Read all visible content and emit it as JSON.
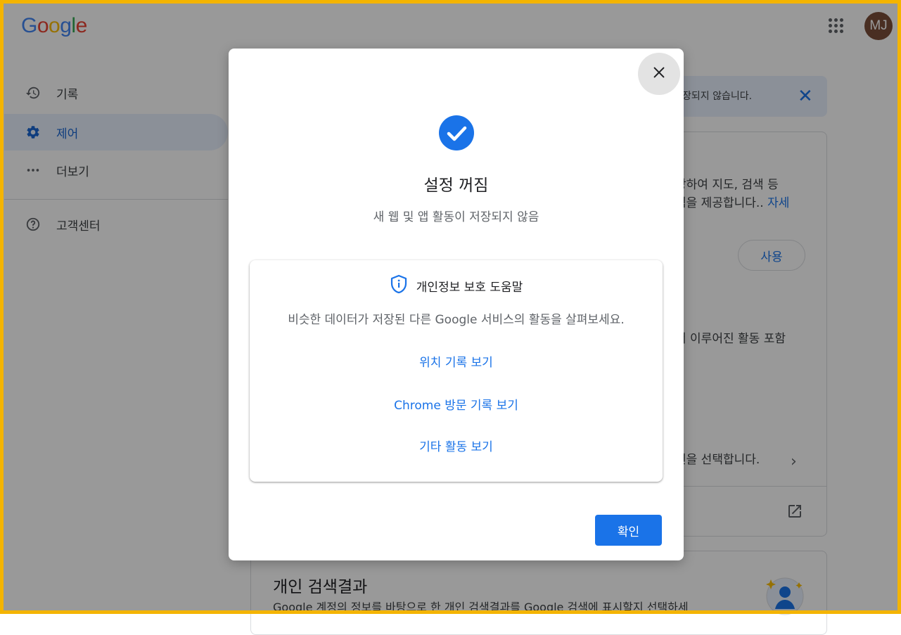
{
  "header": {
    "logo_text": "Google",
    "avatar_initials": "MJ"
  },
  "sidebar": {
    "items": [
      {
        "label": "기록",
        "icon": "history-icon"
      },
      {
        "label": "제어",
        "icon": "gear-icon",
        "active": true
      },
      {
        "label": "더보기",
        "icon": "more-horiz-icon"
      },
      {
        "label": "고객센터",
        "icon": "help-icon"
      }
    ]
  },
  "background": {
    "notice_text": "장되지 않습니다.",
    "card_line1": "장하여 지도, 검색 등",
    "card_line2": "험을 제공합니다..",
    "card_more_link": "자세",
    "use_button": "사용",
    "card_line3": "서 이루어진 활동 포함",
    "card_line4": "션을 선택합니다.",
    "card2_title": "개인 검색결과",
    "card2_desc": "Google 계정의 정보를 바탕으로 한 개인 검색결과를 Google 검색에 표시할지 선택하세"
  },
  "dialog": {
    "title": "설정 꺼짐",
    "subtitle": "새 웹 및 앱 활동이 저장되지 않음",
    "help_label": "개인정보 보호 도움말",
    "help_description": "비슷한 데이터가 저장된 다른 Google 서비스의 활동을 살펴보세요.",
    "links": [
      "위치 기록 보기",
      "Chrome 방문 기록 보기",
      "기타 활동 보기"
    ],
    "ok_button": "확인"
  },
  "colors": {
    "accent": "#1a73e8",
    "frame": "#f4b400",
    "avatar": "#7b4e3a"
  }
}
